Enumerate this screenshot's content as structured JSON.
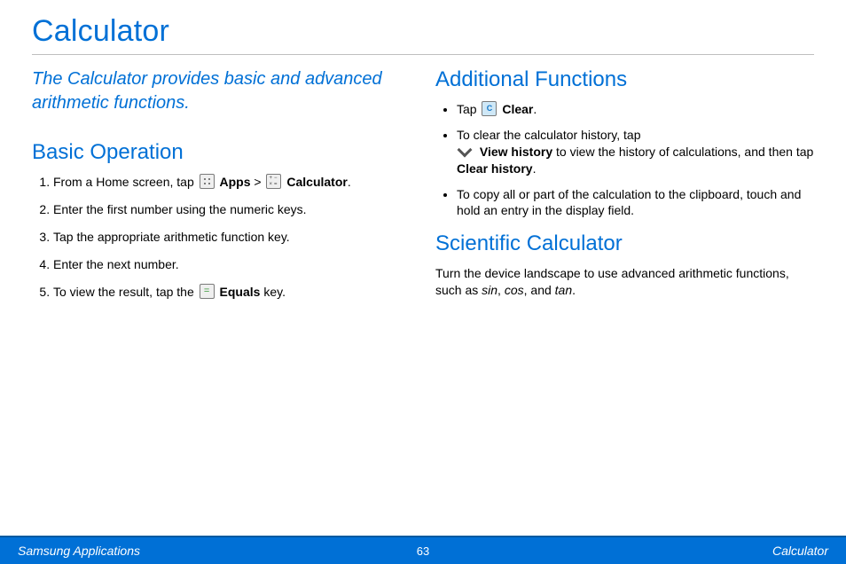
{
  "title": "Calculator",
  "intro": "The Calculator provides basic and advanced arithmetic functions.",
  "left": {
    "heading": "Basic Operation",
    "steps": {
      "s1a": "From a Home screen, tap ",
      "s1_apps": "Apps",
      "s1_gt": " > ",
      "s1_calc": "Calculator",
      "s1_end": ".",
      "s2": "Enter the first number using the numeric keys.",
      "s3": "Tap the appropriate arithmetic function key.",
      "s4": "Enter the next number.",
      "s5a": "To view the result, tap the ",
      "s5_equals": "Equals",
      "s5_end": " key."
    }
  },
  "right": {
    "heading1": "Additional Functions",
    "b1_tap": "Tap ",
    "b1_clear": "Clear",
    "b1_end": ".",
    "b2a": "To clear the calculator history, tap ",
    "b2_view": "View history",
    "b2b": " to view the history of calculations, and then tap ",
    "b2_clearhist": "Clear history",
    "b2_end": ".",
    "b3": "To copy all or part of the calculation to the clipboard, touch and hold an entry in the display field.",
    "heading2": "Scientific Calculator",
    "sci_a": "Turn the device landscape to use advanced arithmetic functions, such as ",
    "sci_sin": "sin",
    "sci_c1": ", ",
    "sci_cos": "cos",
    "sci_c2": ", and ",
    "sci_tan": "tan",
    "sci_end": "."
  },
  "footer": {
    "left": "Samsung Applications",
    "page": "63",
    "right": "Calculator"
  }
}
